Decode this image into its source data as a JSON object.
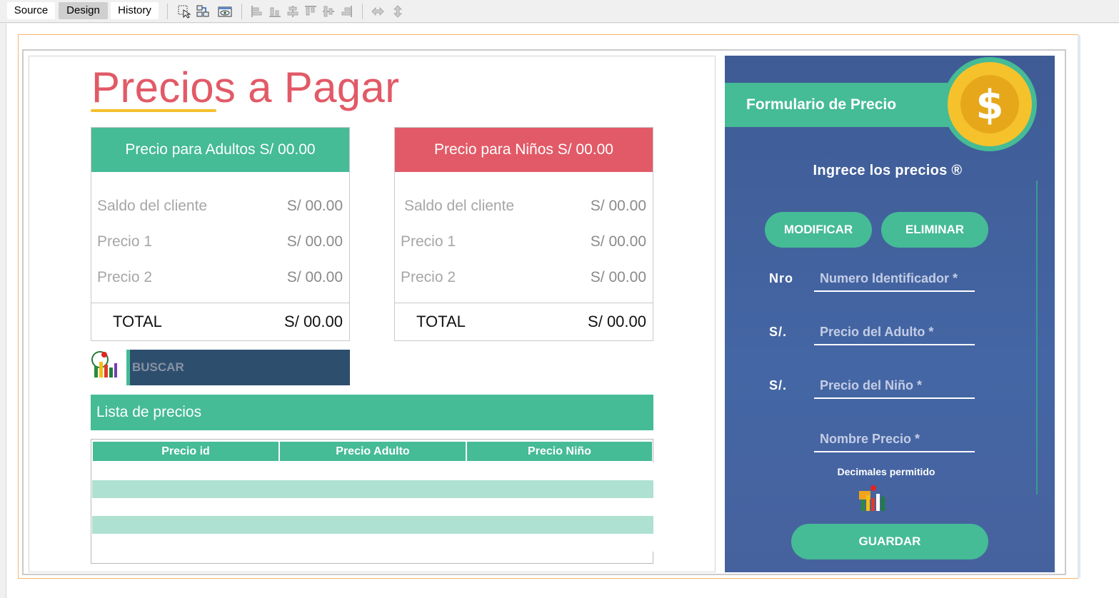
{
  "toolbar": {
    "tabs": [
      {
        "label": "Source",
        "active": false
      },
      {
        "label": "Design",
        "active": true
      },
      {
        "label": "History",
        "active": false
      }
    ],
    "icons": [
      "select-mode-icon",
      "connection-mode-icon",
      "preview-design-icon",
      "align-left-icon",
      "align-bottom-icon",
      "align-center-icon",
      "align-top-icon",
      "align-middle-icon",
      "align-right-icon",
      "same-width-icon",
      "same-height-icon"
    ]
  },
  "left": {
    "title": "Precios a Pagar",
    "cards": [
      {
        "header": "Precio para Adultos S/ 00.00",
        "header_color": "#45bb96",
        "rows": [
          {
            "label": "Saldo del cliente",
            "value": "S/ 00.00"
          },
          {
            "label": "Precio 1",
            "value": "S/ 00.00"
          },
          {
            "label": "Precio 2",
            "value": "S/ 00.00"
          }
        ],
        "total_label": "TOTAL",
        "total_value": "S/ 00.00"
      },
      {
        "header": "Precio para Niños S/ 00.00",
        "header_color": "#e25a67",
        "rows": [
          {
            "label": "Saldo del cliente",
            "value": "S/ 00.00"
          },
          {
            "label": "Precio 1",
            "value": "S/ 00.00"
          },
          {
            "label": "Precio 2",
            "value": "S/ 00.00"
          }
        ],
        "total_label": "TOTAL",
        "total_value": "S/ 00.00"
      }
    ],
    "buscar": "BUSCAR",
    "lista_title": "Lista de precios",
    "table": {
      "columns": [
        "Precio id",
        "Precio Adulto",
        "Precio Niño"
      ],
      "rows": [
        [],
        [],
        [],
        [],
        []
      ]
    }
  },
  "right": {
    "form_title": "Formulario de Precio",
    "coin_symbol": "$",
    "subtitle": "Ingrece los precios ®",
    "buttons": {
      "modify": "MODIFICAR",
      "delete": "ELIMINAR",
      "save": "GUARDAR"
    },
    "fields": [
      {
        "label": "Nro",
        "placeholder": "Numero Identificador *"
      },
      {
        "label": "S/.",
        "placeholder": "Precio del Adulto *"
      },
      {
        "label": "S/.",
        "placeholder": "Precio del Niño *"
      },
      {
        "label": "",
        "placeholder": "Nombre Precio *"
      }
    ],
    "decimals_note": "Decimales permitido"
  },
  "colors": {
    "accent_green": "#45bb96",
    "accent_red": "#e25a67",
    "title_underline": "#f6c02c",
    "panel_blue": "#4466a4",
    "buscar_bg": "#2e4e6e",
    "table_alt_row": "#aee1d1"
  }
}
